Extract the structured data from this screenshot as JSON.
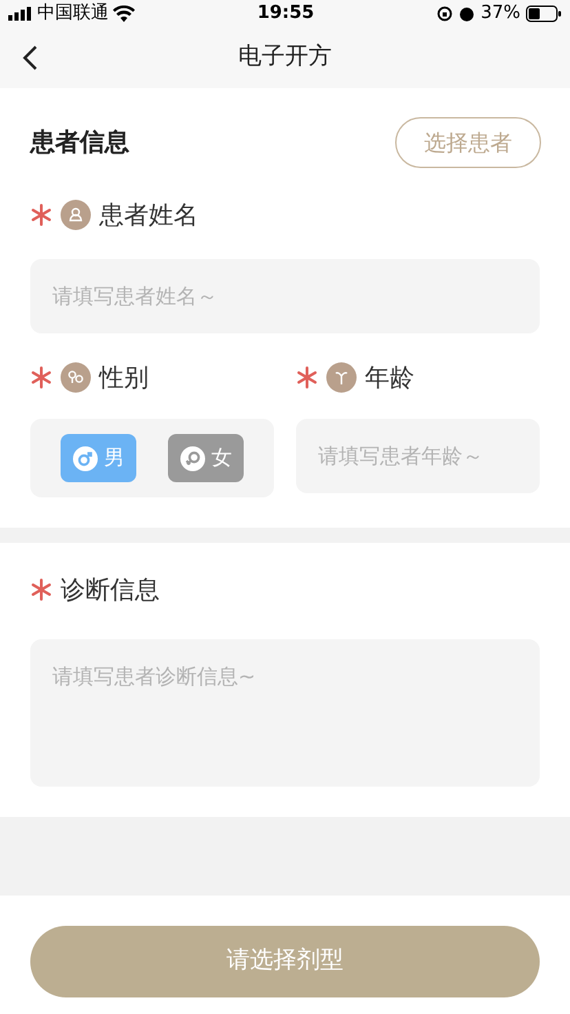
{
  "status_bar": {
    "carrier": "中国联通",
    "time": "19:55",
    "battery": "37%"
  },
  "nav": {
    "title": "电子开方"
  },
  "patient_section": {
    "title": "患者信息",
    "select_button": "选择患者"
  },
  "name_field": {
    "label": "患者姓名",
    "required": true,
    "placeholder": "请填写患者姓名～"
  },
  "gender_field": {
    "label": "性别",
    "required": true,
    "options": [
      {
        "label": "男",
        "kind": "male",
        "selected": true
      },
      {
        "label": "女",
        "kind": "female",
        "selected": false
      }
    ]
  },
  "age_field": {
    "label": "年龄",
    "required": true,
    "placeholder": "请填写患者年龄～"
  },
  "diagnosis_field": {
    "label": "诊断信息",
    "required": true,
    "placeholder": "请填写患者诊断信息~"
  },
  "submit_button": "请选择剂型"
}
